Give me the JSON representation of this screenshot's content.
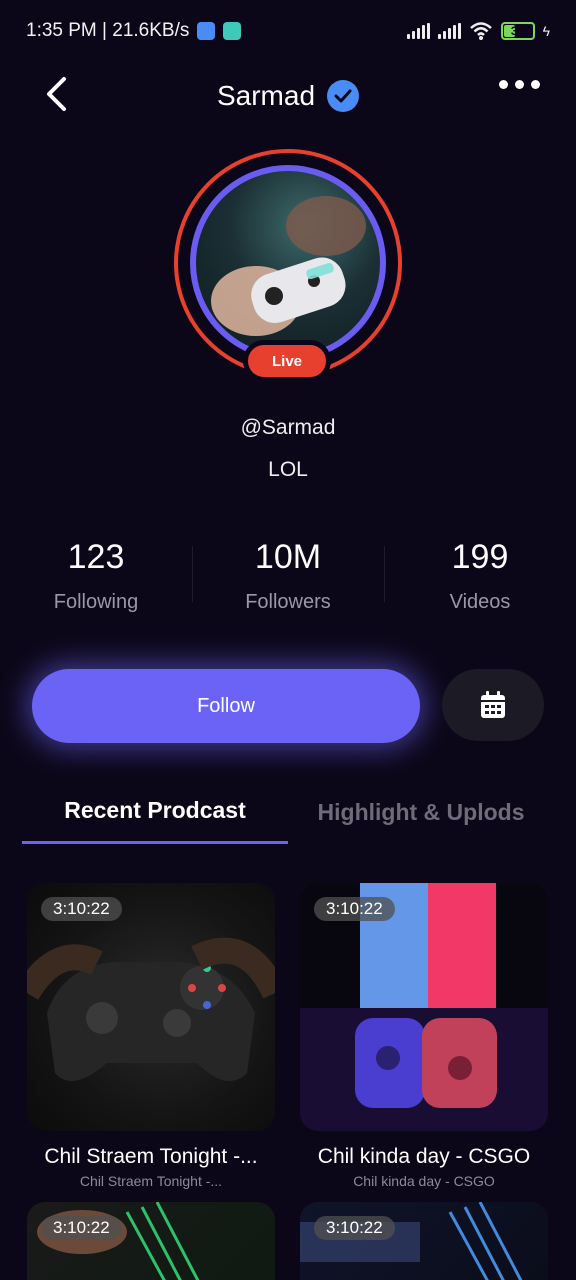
{
  "status_bar": {
    "time_speed": "1:35 PM | 21.6KB/s",
    "battery": "39"
  },
  "header": {
    "title": "Sarmad"
  },
  "profile": {
    "live_label": "Live",
    "handle": "@Sarmad",
    "bio": "LOL"
  },
  "stats": [
    {
      "value": "123",
      "label": "Following"
    },
    {
      "value": "10M",
      "label": "Followers"
    },
    {
      "value": "199",
      "label": "Videos"
    }
  ],
  "actions": {
    "follow_label": "Follow"
  },
  "tabs": [
    {
      "label": "Recent Prodcast",
      "active": true
    },
    {
      "label": "Highlight & Uplods",
      "active": false
    }
  ],
  "videos": [
    {
      "duration": "3:10:22",
      "title": "Chil Straem Tonight -...",
      "subtitle": "Chil Straem Tonight -..."
    },
    {
      "duration": "3:10:22",
      "title": "Chil kinda day - CSGO",
      "subtitle": "Chil kinda day - CSGO"
    },
    {
      "duration": "3:10:22",
      "title": "",
      "subtitle": ""
    },
    {
      "duration": "3:10:22",
      "title": "",
      "subtitle": ""
    }
  ],
  "colors": {
    "background": "#0c0718",
    "accent": "#6a63f5",
    "live": "#e8402e",
    "verified": "#4a8cf5"
  }
}
